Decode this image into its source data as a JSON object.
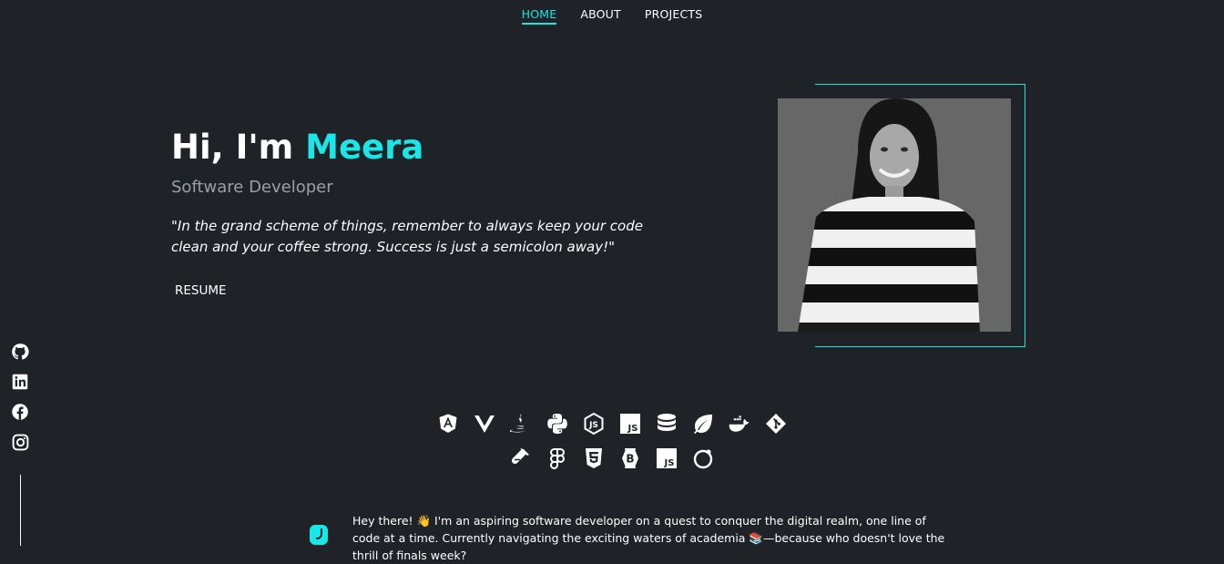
{
  "nav": {
    "items": [
      {
        "label": "HOME",
        "active": true
      },
      {
        "label": "ABOUT",
        "active": false
      },
      {
        "label": "PROJECTS",
        "active": false
      }
    ]
  },
  "hero": {
    "greeting": "Hi, I'm",
    "name": "Meera",
    "subtitle": "Software Developer",
    "quote": "\"In the grand scheme of things, remember to always keep your code clean and your coffee strong. Success is just a semicolon away!\"",
    "resume_label": "RESUME"
  },
  "social": [
    "github-icon",
    "linkedin-icon",
    "facebook-icon",
    "instagram-icon"
  ],
  "tech": {
    "row1": [
      "angular-icon",
      "vue-icon",
      "java-icon",
      "python-icon",
      "nodejs-icon",
      "javascript-icon",
      "database-icon",
      "mongodb-leaf-icon",
      "docker-icon",
      "git-icon"
    ],
    "row2": [
      "flask-icon",
      "figma-icon",
      "css3-icon",
      "bootstrap-icon",
      "javascript-icon",
      "redux-ring-icon"
    ]
  },
  "about": {
    "intro": "Hey there! 👋 I'm an aspiring software developer on a quest to conquer the digital realm, one line of code at a time. Currently navigating the exciting waters of academia 📚—because who doesn't love the thrill of finals week?"
  },
  "colors": {
    "background": "#1f2227",
    "accent": "#19e6e6",
    "muted": "#9aa0a6"
  }
}
